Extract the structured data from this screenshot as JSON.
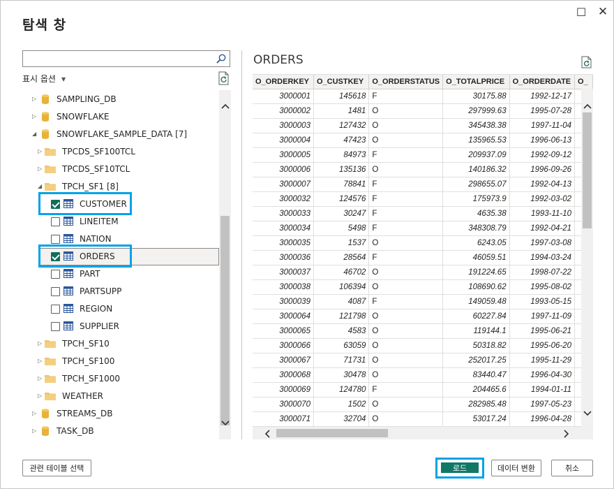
{
  "window": {
    "title": "탐색 창",
    "maximize_glyph": "☐",
    "close_glyph": "✕"
  },
  "navigator": {
    "search": {
      "placeholder": "",
      "value": ""
    },
    "display_options_label": "표시 옵션",
    "tree": [
      {
        "label": "SAMPLING_DB",
        "kind": "database",
        "expander": "collapsed"
      },
      {
        "label": "SNOWFLAKE",
        "kind": "database",
        "expander": "collapsed"
      },
      {
        "label": "SNOWFLAKE_SAMPLE_DATA [7]",
        "kind": "database",
        "expander": "expanded"
      },
      {
        "label": "TPCDS_SF100TCL",
        "kind": "schema",
        "expander": "collapsed"
      },
      {
        "label": "TPCDS_SF10TCL",
        "kind": "schema",
        "expander": "collapsed"
      },
      {
        "label": "TPCH_SF1 [8]",
        "kind": "schema",
        "expander": "expanded"
      },
      {
        "label": "CUSTOMER",
        "kind": "table",
        "checked": true
      },
      {
        "label": "LINEITEM",
        "kind": "table",
        "checked": false
      },
      {
        "label": "NATION",
        "kind": "table",
        "checked": false
      },
      {
        "label": "ORDERS",
        "kind": "table",
        "checked": true
      },
      {
        "label": "PART",
        "kind": "table",
        "checked": false
      },
      {
        "label": "PARTSUPP",
        "kind": "table",
        "checked": false
      },
      {
        "label": "REGION",
        "kind": "table",
        "checked": false
      },
      {
        "label": "SUPPLIER",
        "kind": "table",
        "checked": false
      },
      {
        "label": "TPCH_SF10",
        "kind": "schema",
        "expander": "collapsed"
      },
      {
        "label": "TPCH_SF100",
        "kind": "schema",
        "expander": "collapsed"
      },
      {
        "label": "TPCH_SF1000",
        "kind": "schema",
        "expander": "collapsed"
      },
      {
        "label": "WEATHER",
        "kind": "schema",
        "expander": "collapsed"
      },
      {
        "label": "STREAMS_DB",
        "kind": "database",
        "expander": "collapsed"
      },
      {
        "label": "TASK_DB",
        "kind": "database",
        "expander": "collapsed"
      }
    ]
  },
  "preview": {
    "title": "ORDERS",
    "columns": [
      "O_ORDERKEY",
      "O_CUSTKEY",
      "O_ORDERSTATUS",
      "O_TOTALPRICE",
      "O_ORDERDATE",
      "O_"
    ],
    "rows": [
      [
        "3000001",
        "145618",
        "F",
        "30175.88",
        "1992-12-17",
        ""
      ],
      [
        "3000002",
        "1481",
        "O",
        "297999.63",
        "1995-07-28",
        ""
      ],
      [
        "3000003",
        "127432",
        "O",
        "345438.38",
        "1997-11-04",
        ""
      ],
      [
        "3000004",
        "47423",
        "O",
        "135965.53",
        "1996-06-13",
        ""
      ],
      [
        "3000005",
        "84973",
        "F",
        "209937.09",
        "1992-09-12",
        ""
      ],
      [
        "3000006",
        "135136",
        "O",
        "140186.32",
        "1996-09-26",
        ""
      ],
      [
        "3000007",
        "78841",
        "F",
        "298655.07",
        "1992-04-13",
        ""
      ],
      [
        "3000032",
        "124576",
        "F",
        "175973.9",
        "1992-03-02",
        ""
      ],
      [
        "3000033",
        "30247",
        "F",
        "4635.38",
        "1993-11-10",
        ""
      ],
      [
        "3000034",
        "5498",
        "F",
        "348308.79",
        "1992-04-21",
        ""
      ],
      [
        "3000035",
        "1537",
        "O",
        "6243.05",
        "1997-03-08",
        ""
      ],
      [
        "3000036",
        "28564",
        "F",
        "46059.51",
        "1994-03-24",
        ""
      ],
      [
        "3000037",
        "46702",
        "O",
        "191224.65",
        "1998-07-22",
        ""
      ],
      [
        "3000038",
        "106394",
        "O",
        "108690.62",
        "1995-08-02",
        ""
      ],
      [
        "3000039",
        "4087",
        "F",
        "149059.48",
        "1993-05-15",
        ""
      ],
      [
        "3000064",
        "121798",
        "O",
        "60227.84",
        "1997-11-09",
        ""
      ],
      [
        "3000065",
        "4583",
        "O",
        "119144.1",
        "1995-06-21",
        ""
      ],
      [
        "3000066",
        "63059",
        "O",
        "50318.82",
        "1995-06-20",
        ""
      ],
      [
        "3000067",
        "71731",
        "O",
        "252017.25",
        "1995-11-29",
        ""
      ],
      [
        "3000068",
        "30478",
        "O",
        "83440.47",
        "1996-04-30",
        ""
      ],
      [
        "3000069",
        "124780",
        "F",
        "204465.6",
        "1994-01-11",
        ""
      ],
      [
        "3000070",
        "1502",
        "O",
        "282985.48",
        "1997-05-23",
        ""
      ],
      [
        "3000071",
        "32704",
        "O",
        "53017.24",
        "1996-04-28",
        ""
      ]
    ]
  },
  "footer": {
    "related_tables_label": "관련 테이블 선택",
    "load_label": "로드",
    "transform_label": "데이터 변환",
    "cancel_label": "취소"
  },
  "colors": {
    "checkbox_checked": "#106e5b",
    "load_button": "#117865",
    "highlight_box": "#00a2e8"
  },
  "icons": {
    "search": "search-icon",
    "refresh": "refresh-icon",
    "database": "database-icon",
    "folder": "folder-icon",
    "table": "table-icon"
  }
}
